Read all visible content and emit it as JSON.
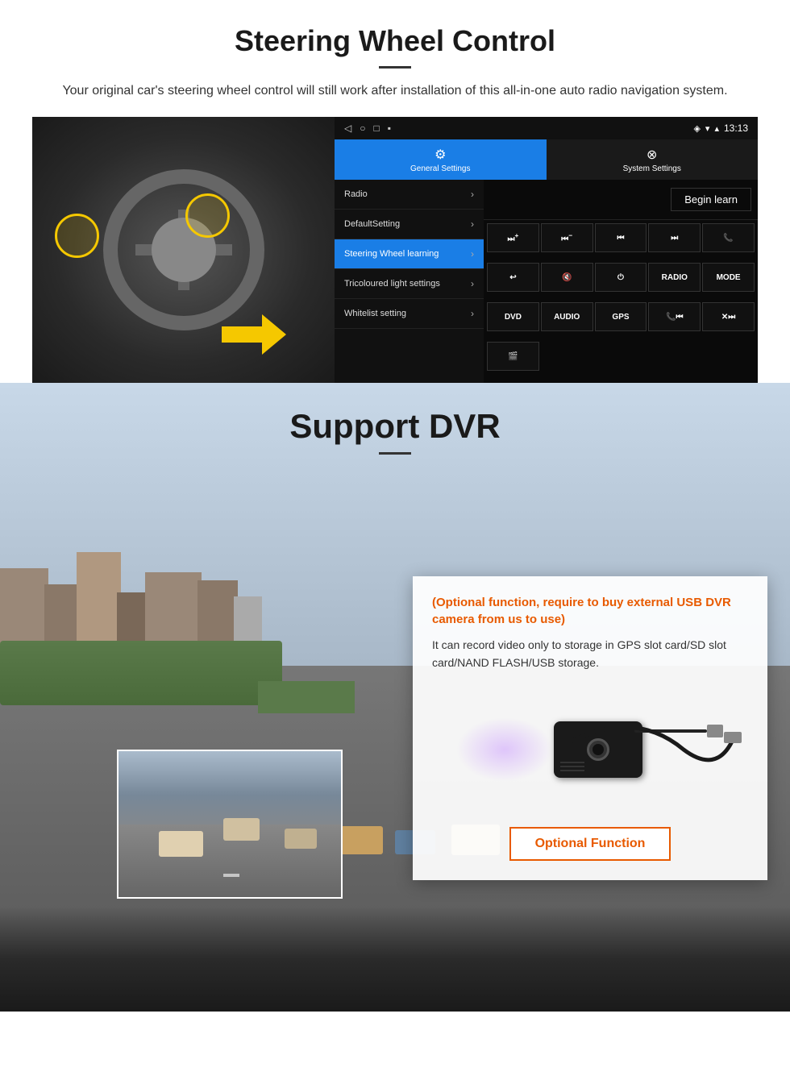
{
  "steering": {
    "title": "Steering Wheel Control",
    "subtitle": "Your original car's steering wheel control will still work after installation of this all-in-one auto radio navigation system.",
    "divider": "—",
    "android": {
      "time": "13:13",
      "tab_general": "General Settings",
      "tab_system": "System Settings",
      "menu_items": [
        {
          "label": "Radio",
          "active": false
        },
        {
          "label": "DefaultSetting",
          "active": false
        },
        {
          "label": "Steering Wheel learning",
          "active": true
        },
        {
          "label": "Tricoloured light settings",
          "active": false
        },
        {
          "label": "Whitelist setting",
          "active": false
        }
      ],
      "begin_learn": "Begin learn",
      "controls": [
        "⏭+",
        "⏮−",
        "⏮⏮",
        "⏭⏭",
        "📞",
        "↩",
        "🔇",
        "⏻",
        "RADIO",
        "MODE",
        "DVD",
        "AUDIO",
        "GPS",
        "📞⏮",
        "✕⏭"
      ]
    }
  },
  "dvr": {
    "title": "Support DVR",
    "divider": "—",
    "optional_text": "(Optional function, require to buy external USB DVR camera from us to use)",
    "description": "It can record video only to storage in GPS slot card/SD slot card/NAND FLASH/USB storage.",
    "optional_function_btn": "Optional Function"
  }
}
